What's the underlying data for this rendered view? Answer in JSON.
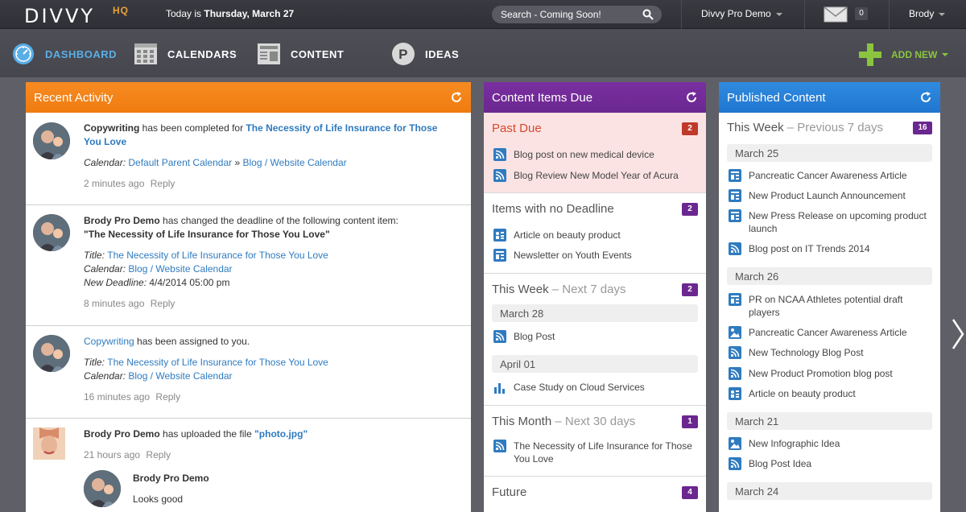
{
  "topbar": {
    "logo": "DIVVY",
    "logo_suffix": "HQ",
    "today_prefix": "Today is ",
    "today_date": "Thursday, March 27",
    "search_placeholder": "Search - Coming Soon!",
    "account": "Divvy Pro Demo",
    "mail_count": "0",
    "user": "Brody"
  },
  "nav": {
    "items": [
      {
        "label": "DASHBOARD",
        "icon": "dashboard-icon",
        "active": true
      },
      {
        "label": "CALENDARS",
        "icon": "calendar-icon",
        "active": false
      },
      {
        "label": "CONTENT",
        "icon": "content-icon",
        "active": false
      },
      {
        "label": "IDEAS",
        "icon": "ideas-icon",
        "active": false
      }
    ],
    "add_new": "ADD NEW"
  },
  "colors": {
    "accent_blue": "#5aaee6",
    "orange": "#f68b22",
    "purple": "#6b2790",
    "blue": "#2f8be0",
    "green": "#8bc53f",
    "red": "#c0392b"
  },
  "recent_activity": {
    "title": "Recent Activity",
    "entries": [
      {
        "actor": "Copywriting",
        "action": " has been completed for ",
        "target": "The Necessity of Life Insurance for Those You Love",
        "calendar_label": "Calendar: ",
        "calendar_parent": "Default Parent Calendar",
        "calendar_sep": " » ",
        "calendar_child": "Blog / Website Calendar",
        "time": "2 minutes ago",
        "reply": "Reply"
      },
      {
        "actor": "Brody Pro Demo",
        "action": " has changed the deadline of the following content item:",
        "quote": "\"The Necessity of Life Insurance for Those You Love\"",
        "title_label": "Title: ",
        "title_value": "The Necessity of Life Insurance for Those You Love",
        "calendar_label": "Calendar: ",
        "calendar_value": "Blog / Website Calendar",
        "deadline_label": "New Deadline: ",
        "deadline_value": "4/4/2014 05:00 pm",
        "time": "8 minutes ago",
        "reply": "Reply"
      },
      {
        "actor": "Copywriting",
        "action": " has been assigned to you.",
        "title_label": "Title: ",
        "title_value": "The Necessity of Life Insurance for Those You Love",
        "calendar_label": "Calendar: ",
        "calendar_value": "Blog / Website Calendar",
        "time": "16 minutes ago",
        "reply": "Reply"
      },
      {
        "actor": "Brody Pro Demo",
        "action": " has uploaded the file ",
        "file": "\"photo.jpg\"",
        "time": "21 hours ago",
        "reply": "Reply",
        "comment_author": "Brody Pro Demo",
        "comment_text": "Looks good"
      }
    ]
  },
  "content_due": {
    "title": "Content Items Due",
    "past_due": {
      "title": "Past Due",
      "count": "2",
      "items": [
        "Blog post on new medical device",
        "Blog Review New Model Year of Acura"
      ]
    },
    "no_deadline": {
      "title": "Items with no Deadline",
      "count": "2",
      "items": [
        "Article on beauty product",
        "Newsletter on Youth Events"
      ]
    },
    "this_week": {
      "title": "This Week",
      "sub": " – Next 7 days",
      "count": "2",
      "groups": [
        {
          "date": "March 28",
          "items": [
            "Blog Post"
          ]
        },
        {
          "date": "April 01",
          "items": [
            "Case Study on Cloud Services"
          ]
        }
      ]
    },
    "this_month": {
      "title": "This Month",
      "sub": " – Next 30 days",
      "count": "1",
      "items": [
        "The Necessity of Life Insurance for Those You Love"
      ]
    },
    "future": {
      "title": "Future",
      "count": "4"
    }
  },
  "published": {
    "title": "Published Content",
    "this_week": {
      "title": "This Week",
      "sub": " – Previous 7 days",
      "count": "16"
    },
    "groups": [
      {
        "date": "March 25",
        "items": [
          "Pancreatic Cancer Awareness Article",
          "New Product Launch Announcement",
          "New Press Release on upcoming product launch",
          "Blog post on IT Trends 2014"
        ]
      },
      {
        "date": "March 26",
        "items": [
          "PR on NCAA Athletes potential draft players",
          "Pancreatic Cancer Awareness Article",
          "New Technology Blog Post",
          "New Product Promotion blog post",
          "Article on beauty product"
        ]
      },
      {
        "date": "March 21",
        "items": [
          "New Infographic Idea",
          "Blog Post Idea"
        ]
      },
      {
        "date": "March 24",
        "items": []
      }
    ]
  }
}
